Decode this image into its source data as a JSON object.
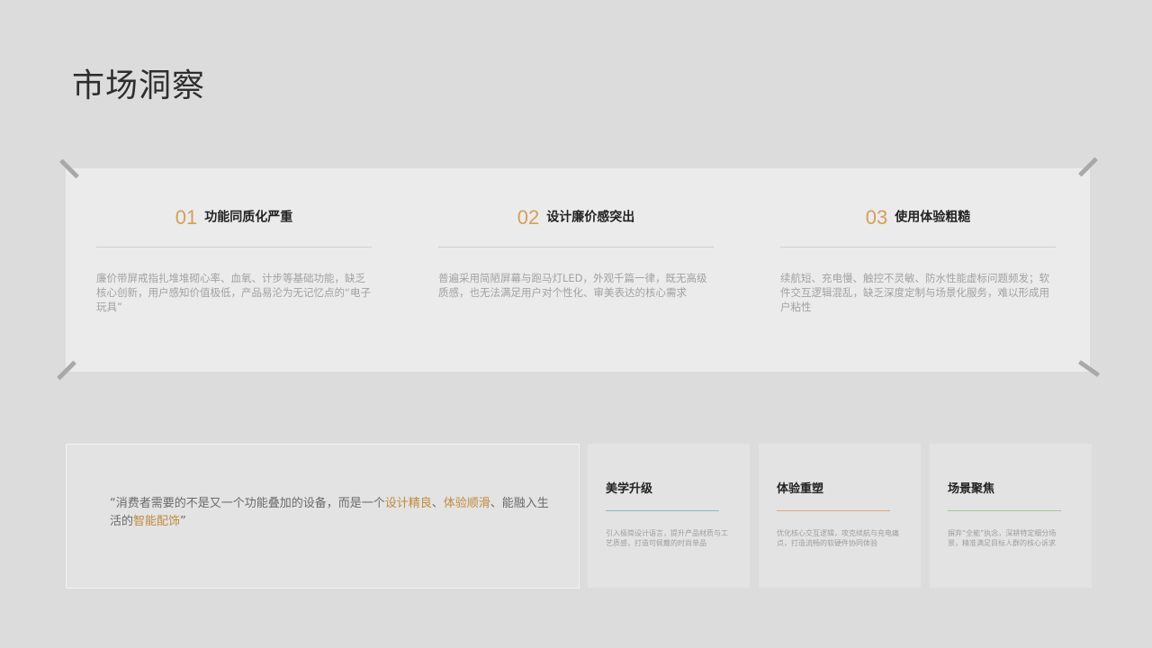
{
  "page": {
    "title": "市场洞察"
  },
  "insights": [
    {
      "num": "01",
      "title": "功能同质化严重",
      "desc": "廉价带屏戒指扎堆堆砌心率、血氧、计步等基础功能，缺乏核心创新，用户感知价值极低，产品易沦为无记忆点的“电子玩具”"
    },
    {
      "num": "02",
      "title": "设计廉价感突出",
      "desc": "普遍采用简陋屏幕与跑马灯LED，外观千篇一律，既无高级质感，也无法满足用户对个性化、审美表达的核心需求"
    },
    {
      "num": "03",
      "title": "使用体验粗糙",
      "desc": "续航短、充电慢、触控不灵敏、防水性能虚标问题频发；软件交互逻辑混乱，缺乏深度定制与场景化服务，难以形成用户粘性"
    }
  ],
  "quote": {
    "prefix": "“消费者需要的不是又一个功能叠加的设备，而是一个",
    "hl1": "设计精良",
    "sep1": "、",
    "hl2": "体验顺滑",
    "sep2": "、能融入生活的",
    "hl3": "智能配饰",
    "suffix": "”"
  },
  "pillars": [
    {
      "title": "美学升级",
      "desc": "引入极简设计语言，提升产品材质与工艺质感，打造可佩戴的时尚单品",
      "accent": "#8fb6c6"
    },
    {
      "title": "体验重塑",
      "desc": "优化核心交互逻辑，攻克续航与充电痛点，打造流畅的软硬件协同体验",
      "accent": "#d6ad7a"
    },
    {
      "title": "场景聚焦",
      "desc": "摒弃“全能”执念，深耕特定细分场景，精准满足目标人群的核心诉求",
      "accent": "#a7c49a"
    }
  ],
  "colors": {
    "background": "#dcdcdc",
    "panel": "#ebebeb",
    "accent": "#d4a05a",
    "highlight": "#c08a3e"
  }
}
